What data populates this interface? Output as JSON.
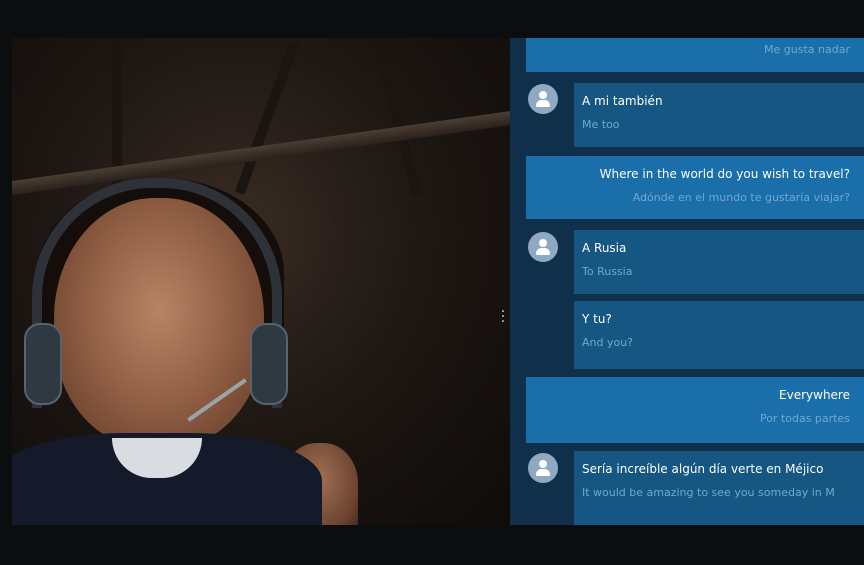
{
  "conversation": [
    {
      "sender": "me",
      "text": "",
      "translation": "Me gusta nadar"
    },
    {
      "sender": "them",
      "text": "A mi también",
      "translation": "Me too"
    },
    {
      "sender": "me",
      "text": "Where in the world do you wish to travel?",
      "translation": "Adónde en el mundo te gustaría viajar?"
    },
    {
      "sender": "them",
      "text": "A Rusia",
      "translation": "To Russia"
    },
    {
      "sender": "them",
      "text": "Y tu?",
      "translation": "And you?"
    },
    {
      "sender": "me",
      "text": "Everywhere",
      "translation": "Por todas partes"
    },
    {
      "sender": "them",
      "text": "Sería increíble algún día verte en Méjico",
      "translation": "It would be amazing to see you someday in M"
    }
  ],
  "icons": {
    "avatar": "person-avatar-icon",
    "divider_handle": "vertical-ellipsis-icon"
  },
  "colors": {
    "panel_bg": "#0f2f4b",
    "own_bubble": "#1a6ea9",
    "their_bubble": "#155683",
    "translation_text": "#6fa8d3"
  }
}
